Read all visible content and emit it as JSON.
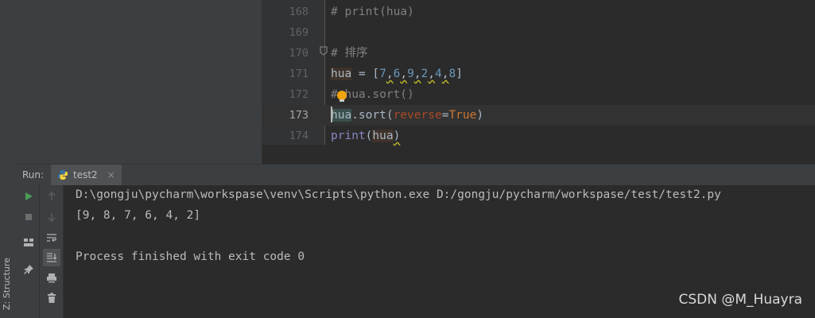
{
  "editor": {
    "lines": [
      {
        "num": "168",
        "segments": [
          {
            "t": "# print(hua)",
            "c": "cm"
          }
        ]
      },
      {
        "num": "169",
        "segments": []
      },
      {
        "num": "170",
        "segments": [
          {
            "t": "# 排序",
            "c": "cm"
          }
        ]
      },
      {
        "num": "171",
        "segments": [
          {
            "t": "hua",
            "c": "hl2"
          },
          {
            "t": " = [",
            "c": ""
          },
          {
            "t": "7",
            "c": "num"
          },
          {
            "t": ",",
            "c": "squig"
          },
          {
            "t": "6",
            "c": "num"
          },
          {
            "t": ",",
            "c": "squig"
          },
          {
            "t": "9",
            "c": "num"
          },
          {
            "t": ",",
            "c": "squig"
          },
          {
            "t": "2",
            "c": "num"
          },
          {
            "t": ",",
            "c": "squig"
          },
          {
            "t": "4",
            "c": "num"
          },
          {
            "t": ",",
            "c": "squig"
          },
          {
            "t": "8",
            "c": "num"
          },
          {
            "t": "]",
            "c": ""
          }
        ]
      },
      {
        "num": "172",
        "segments": [
          {
            "t": "# hua.sort()",
            "c": "cm"
          }
        ]
      },
      {
        "num": "173",
        "current": true,
        "segments": [
          {
            "t": "hua",
            "c": "hl"
          },
          {
            "t": ".sort(",
            "c": ""
          },
          {
            "t": "reverse",
            "c": "param"
          },
          {
            "t": "=",
            "c": ""
          },
          {
            "t": "True",
            "c": "kw"
          },
          {
            "t": ")",
            "c": ""
          }
        ]
      },
      {
        "num": "174",
        "segments": [
          {
            "t": "print",
            "c": "fn"
          },
          {
            "t": "(",
            "c": ""
          },
          {
            "t": "hua",
            "c": "hl2"
          },
          {
            "t": ")",
            "c": "squig"
          }
        ]
      }
    ]
  },
  "run_panel": {
    "label": "Run:",
    "tab_label": "test2",
    "close_glyph": "×",
    "structure_label": "Z: Structure",
    "output": [
      "D:\\gongju\\pycharm\\workspase\\venv\\Scripts\\python.exe D:/gongju/pycharm/workspase/test/test2.py",
      "[9, 8, 7, 6, 4, 2]",
      "",
      "Process finished with exit code 0"
    ]
  },
  "icons": {
    "run": "play-icon",
    "stop": "stop-icon",
    "layout": "layout-icon",
    "pin": "pin-icon",
    "up": "arrow-up-icon",
    "down": "arrow-down-icon",
    "wrap": "soft-wrap-icon",
    "scroll_end": "scroll-to-end-icon",
    "print": "print-icon",
    "trash": "trash-icon"
  },
  "colors": {
    "run_green": "#499c54",
    "python_blue": "#3572a5",
    "python_yellow": "#ffd43b"
  },
  "watermark": "CSDN @M_Huayra"
}
